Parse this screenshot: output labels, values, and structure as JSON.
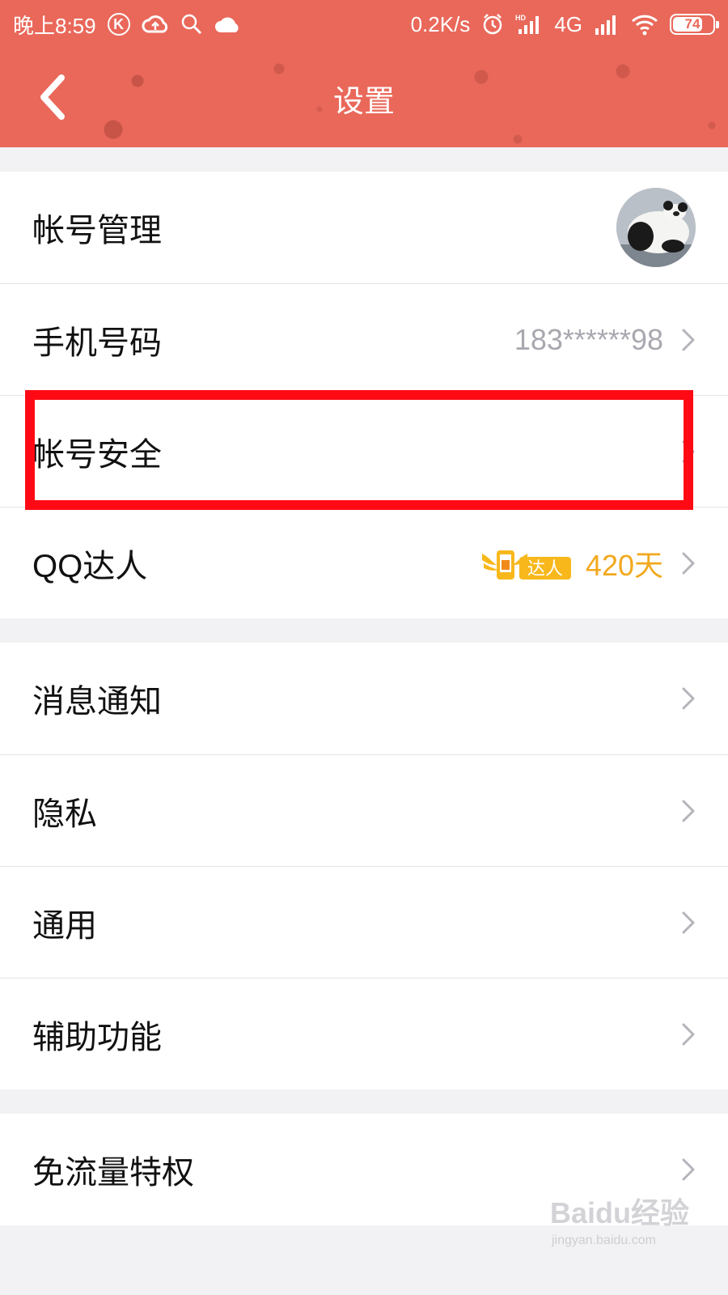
{
  "status_bar": {
    "time": "晚上8:59",
    "left_icons": [
      "k-icon",
      "cloud-upload-icon",
      "search-icon",
      "cloud-icon"
    ],
    "net_speed": "0.2K/s",
    "network": "4G",
    "battery_level": "74",
    "battery_fraction": 0.74
  },
  "nav": {
    "title": "设置",
    "back_icon": "chevron-left-icon",
    "color": "#e9685a"
  },
  "groups": [
    {
      "rows": [
        {
          "label": "帐号管理",
          "trailing": "avatar"
        },
        {
          "label": "手机号码",
          "value": "183******98"
        },
        {
          "label": "帐号安全"
        },
        {
          "label": "QQ达人",
          "badge_text": "达人",
          "value": "420天"
        }
      ]
    },
    {
      "rows": [
        {
          "label": "消息通知"
        },
        {
          "label": "隐私"
        },
        {
          "label": "通用"
        },
        {
          "label": "辅助功能"
        }
      ]
    },
    {
      "rows": [
        {
          "label": "免流量特权"
        }
      ]
    }
  ],
  "highlight": {
    "target": "帐号安全",
    "color": "#ff0a14"
  },
  "watermark": {
    "logo": "Baidu经验",
    "url": "jingyan.baidu.com"
  }
}
